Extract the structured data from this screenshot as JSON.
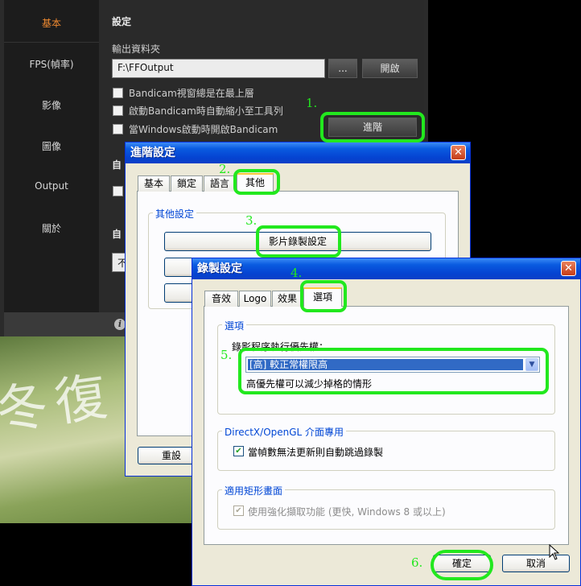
{
  "bandicam": {
    "nav": [
      "基本",
      "FPS(幀率)",
      "影像",
      "圖像",
      "Output",
      "關於"
    ],
    "section_title": "設定",
    "output_folder_label": "輸出資料夾",
    "output_folder_value": "F:\\FFOutput",
    "browse_label": "...",
    "open_label": "開啟",
    "options": [
      "Bandicam視窗總是在最上層",
      "啟動Bandicam時自動縮小至工具列",
      "當Windows啟動時開啟Bandicam"
    ],
    "advanced_label": "進階",
    "hidden_label_1": "自",
    "hidden_label_2": "自",
    "dropdown_stub": "不"
  },
  "advanced_dialog": {
    "title": "進階設定",
    "close": "✕",
    "tabs": [
      "基本",
      "鎖定",
      "語言",
      "其他"
    ],
    "group_title": "其他設定",
    "video_settings_button": "影片錄製設定",
    "reset_button": "重設"
  },
  "record_dialog": {
    "title": "錄製設定",
    "close": "✕",
    "tabs": [
      "音效",
      "Logo",
      "效果",
      "選項"
    ],
    "options_group": "選項",
    "priority_label": "錄影程序執行優先權：",
    "priority_value": "[高] 較正常權限高",
    "priority_note": "高優先權可以減少掉格的情形",
    "directx_group": "DirectX/OpenGL 介面專用",
    "skip_frames_label": "當幀數無法更新則自動跳過錄製",
    "rect_group": "適用矩形畫面",
    "enhanced_capture_label": "使用強化擷取功能 (更快, Windows 8 或以上)",
    "ok_button": "確定",
    "cancel_button": "取消"
  },
  "annotations": [
    "1.",
    "2.",
    "3.",
    "4.",
    "5.",
    "6."
  ],
  "photo_text": "冬復",
  "colors": {
    "highlight": "#22e81e",
    "accent": "#f08a30",
    "xp_title": "#0544d2"
  }
}
